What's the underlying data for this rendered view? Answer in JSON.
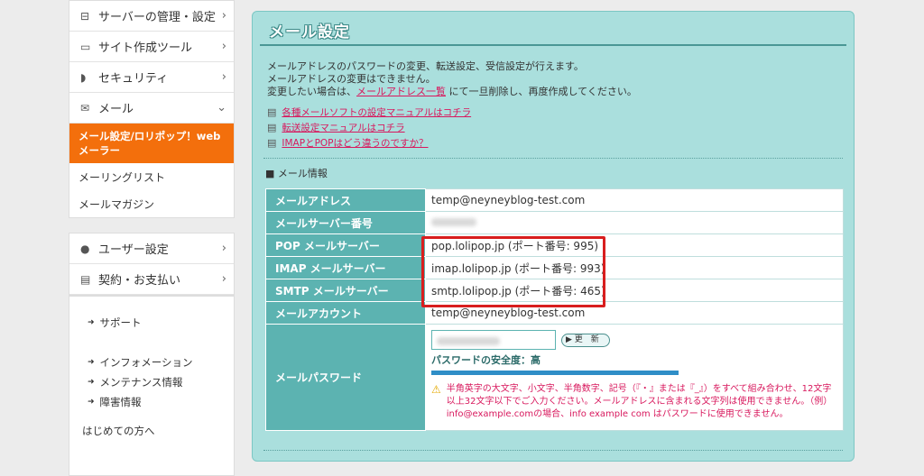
{
  "sidebar": {
    "top_items": [
      {
        "label": "サーバーの管理・設定",
        "icon": "server-icon",
        "chevron": "›"
      },
      {
        "label": "サイト作成ツール",
        "icon": "laptop-icon",
        "chevron": "›"
      },
      {
        "label": "セキュリティ",
        "icon": "shield-icon",
        "chevron": "›"
      },
      {
        "label": "メール",
        "icon": "mail-icon",
        "chevron": "⌄"
      }
    ],
    "active_sub": "メール設定/ロリポップ！webメーラー",
    "sub_items": [
      "メーリングリスト",
      "メールマガジン"
    ],
    "mid_items": [
      {
        "label": "ユーザー設定",
        "icon": "user-icon",
        "chevron": "›"
      },
      {
        "label": "契約・お支払い",
        "icon": "card-icon",
        "chevron": "›"
      }
    ],
    "support_items": [
      "サポート",
      "インフォメーション",
      "メンテナンス情報",
      "障害情報",
      "はじめての方へ"
    ]
  },
  "panel": {
    "title": "メール設定",
    "intro_line1": "メールアドレスのパスワードの変更、転送設定、受信設定が行えます。",
    "intro_line2": "メールアドレスの変更はできません。",
    "intro_line3_pre": "変更したい場合は、",
    "intro_line3_link": "メールアドレス一覧",
    "intro_line3_post": " にて一旦削除し、再度作成してください。",
    "links": [
      "各種メールソフトの設定マニュアルはコチラ",
      "転送設定マニュアルはコチラ",
      "IMAPとPOPはどう違うのですか？"
    ],
    "section_heading": "■ メール情報"
  },
  "mail_info": {
    "address_label": "メールアドレス",
    "address_value": "temp@neyneyblog-test.com",
    "server_no_label": "メールサーバー番号",
    "pop_label": "POP メールサーバー",
    "pop_value": "pop.lolipop.jp (ポート番号: 995)",
    "imap_label": "IMAP メールサーバー",
    "imap_value": "imap.lolipop.jp (ポート番号: 993)",
    "smtp_label": "SMTP メールサーバー",
    "smtp_value": "smtp.lolipop.jp (ポート番号: 465)",
    "account_label": "メールアカウント",
    "account_value": "temp@neyneyblog-test.com",
    "password_label": "メールパスワード",
    "update_button": "▶ 更　新",
    "strength_text": "パスワードの安全度：高",
    "warning_text": "半角英字の大文字、小文字、半角数字、記号（『・』または『_』）をすべて組み合わせ、12文字以上32文字以下でご入力ください。メールアドレスに含まれる文字列は使用できません。（例）info@example.comの場合、info example com はパスワードに使用できません。"
  },
  "colors": {
    "accent": "#f36f0c",
    "panel_bg": "#aadfdd",
    "header_cell": "#5cb3b1",
    "link": "#d8185d",
    "highlight": "#d81e1e"
  }
}
